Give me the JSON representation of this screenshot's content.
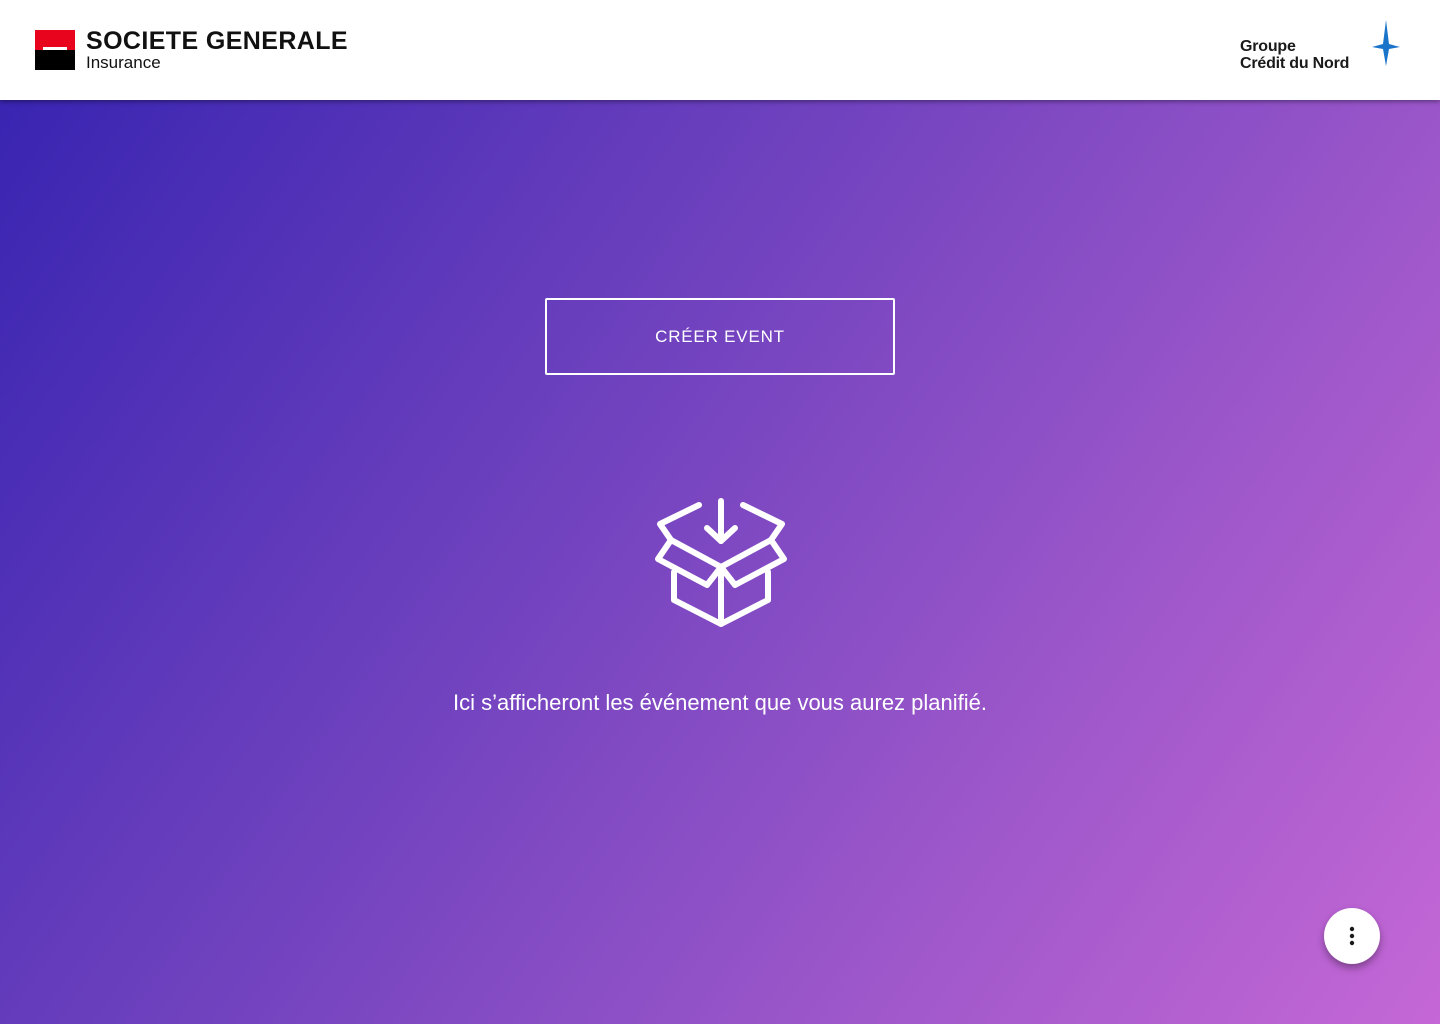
{
  "header": {
    "brand_name": "SOCIETE GENERALE",
    "brand_sub": "Insurance",
    "partner_line1": "Groupe",
    "partner_line2": "Crédit du Nord",
    "brand_colors": {
      "red": "#e9041e",
      "black": "#000000",
      "star": "#1a74c9"
    }
  },
  "main": {
    "create_button_label": "CRÉER EVENT",
    "empty_icon": "box-download-icon",
    "empty_message": "Ici s’afficheront les événement que vous aurez planifié."
  },
  "fab": {
    "icon": "more-vertical-icon"
  },
  "theme": {
    "gradient_start": "#3422b0",
    "gradient_end": "#c567d6"
  }
}
